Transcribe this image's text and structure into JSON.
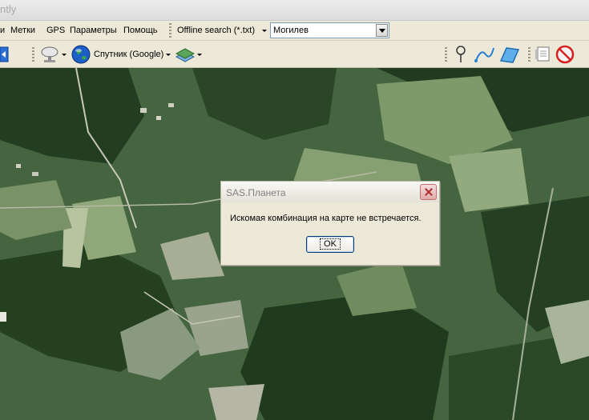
{
  "window": {
    "title_fragment": "ntly"
  },
  "menu": {
    "items": [
      {
        "label": "и"
      },
      {
        "label": "Метки"
      },
      {
        "label": "GPS"
      },
      {
        "label": "Параметры"
      },
      {
        "label": "Помощь"
      }
    ]
  },
  "search": {
    "provider_label": "Offline search (*.txt)",
    "query_value": "Могилев"
  },
  "toolbar": {
    "map_source_label": "Спутник (Google)",
    "icons": [
      "move-icon",
      "satellite-dish-icon",
      "globe-icon",
      "layers-icon",
      "placemark-icon",
      "path-icon",
      "polygon-icon",
      "notes-icon",
      "delete-marks-icon"
    ]
  },
  "dialog": {
    "title": "SAS.Планета",
    "message": "Искомая комбинация на карте не встречается.",
    "ok_label": "OK"
  },
  "colors": {
    "toolbar_bg": "#ece9d8",
    "ok_border": "#003c74",
    "close_red": "#c76d6d"
  }
}
